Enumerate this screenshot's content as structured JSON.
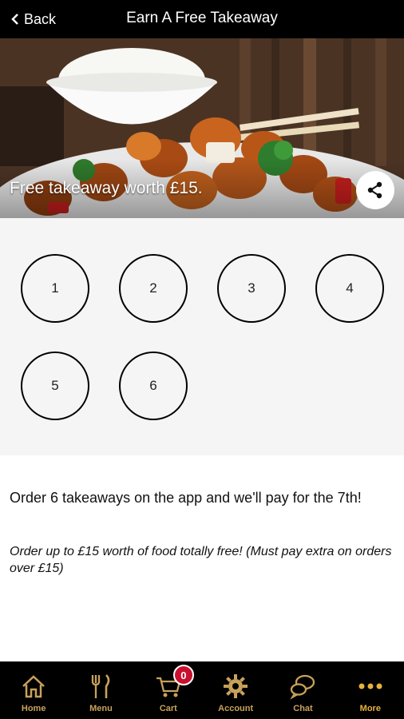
{
  "header": {
    "back_label": "Back",
    "title": "Earn A Free Takeaway"
  },
  "hero": {
    "caption": "Free takeaway worth £15.",
    "share_icon": "share-icon"
  },
  "stamps": {
    "items": [
      "1",
      "2",
      "3",
      "4",
      "5",
      "6"
    ]
  },
  "description": {
    "main": "Order 6 takeaways on the app and we'll pay for the 7th!",
    "sub": "Order up to £15 worth of food totally free! (Must pay extra on orders over £15)"
  },
  "tabbar": {
    "items": [
      {
        "label": "Home",
        "icon": "home-icon"
      },
      {
        "label": "Menu",
        "icon": "cutlery-icon"
      },
      {
        "label": "Cart",
        "icon": "cart-icon",
        "badge": "0"
      },
      {
        "label": "Account",
        "icon": "gear-icon"
      },
      {
        "label": "Chat",
        "icon": "chat-icon"
      },
      {
        "label": "More",
        "icon": "more-icon",
        "active": true
      }
    ]
  },
  "colors": {
    "header_bg": "#000000",
    "tab_label": "#c8a25a",
    "active_tab": "#e8b23a",
    "badge": "#c8102e",
    "stamp_area_bg": "#f5f5f5"
  }
}
